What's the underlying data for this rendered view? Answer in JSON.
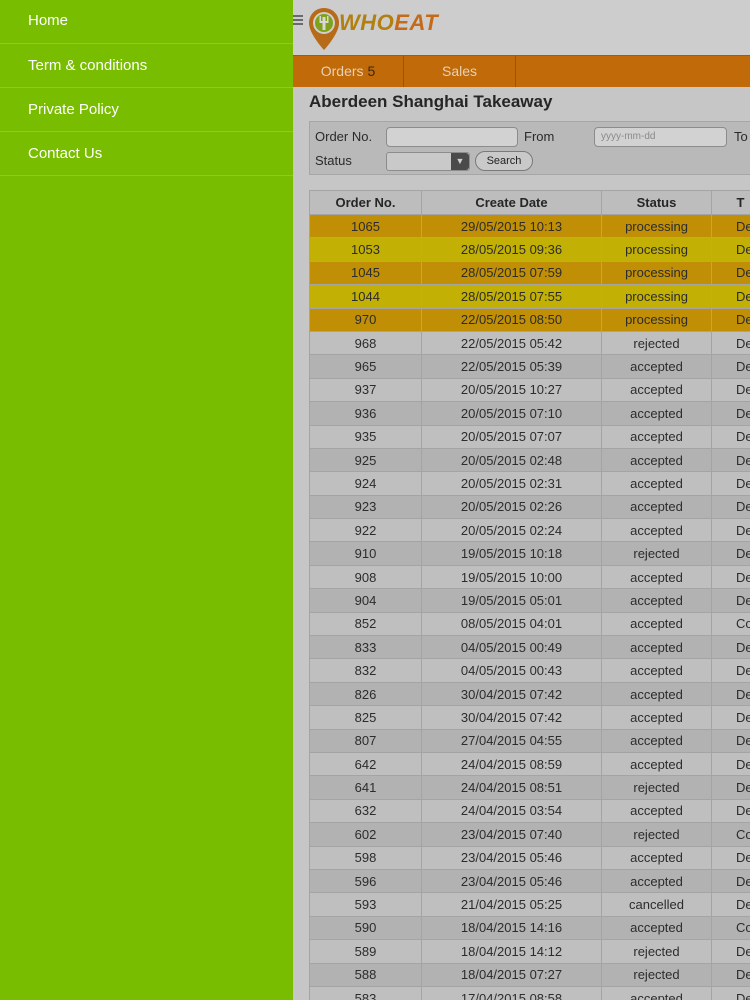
{
  "drawer": {
    "items": [
      {
        "label": "Home"
      },
      {
        "label": "Term & conditions"
      },
      {
        "label": "Private Policy"
      },
      {
        "label": "Contact Us"
      }
    ]
  },
  "header": {
    "logo_text_who": "WHO",
    "logo_text_eat": "EAT",
    "tabs": {
      "orders_label": "Orders",
      "orders_count": "5",
      "sales_label": "Sales"
    }
  },
  "store_title": "Aberdeen Shanghai Takeaway",
  "filter": {
    "order_no_label": "Order No.",
    "from_label": "From",
    "from_placeholder": "yyyy-mm-dd",
    "to_label": "To",
    "status_label": "Status",
    "search_label": "Search"
  },
  "table": {
    "headers": [
      "Order No.",
      "Create Date",
      "Status",
      "T"
    ],
    "rows": [
      {
        "order": "1065",
        "date": "29/05/2015 10:13",
        "status": "processing",
        "type": "De",
        "style": "proc-a"
      },
      {
        "order": "1053",
        "date": "28/05/2015 09:36",
        "status": "processing",
        "type": "De",
        "style": "proc-b"
      },
      {
        "order": "1045",
        "date": "28/05/2015 07:59",
        "status": "processing",
        "type": "De",
        "style": "proc-a"
      },
      {
        "order": "1044",
        "date": "28/05/2015 07:55",
        "status": "processing",
        "type": "De",
        "style": "proc-b"
      },
      {
        "order": "970",
        "date": "22/05/2015 08:50",
        "status": "processing",
        "type": "De",
        "style": "proc-a"
      },
      {
        "order": "968",
        "date": "22/05/2015 05:42",
        "status": "rejected",
        "type": "De",
        "style": "odd"
      },
      {
        "order": "965",
        "date": "22/05/2015 05:39",
        "status": "accepted",
        "type": "De",
        "style": "even"
      },
      {
        "order": "937",
        "date": "20/05/2015 10:27",
        "status": "accepted",
        "type": "De",
        "style": "odd"
      },
      {
        "order": "936",
        "date": "20/05/2015 07:10",
        "status": "accepted",
        "type": "De",
        "style": "even"
      },
      {
        "order": "935",
        "date": "20/05/2015 07:07",
        "status": "accepted",
        "type": "De",
        "style": "odd"
      },
      {
        "order": "925",
        "date": "20/05/2015 02:48",
        "status": "accepted",
        "type": "De",
        "style": "even"
      },
      {
        "order": "924",
        "date": "20/05/2015 02:31",
        "status": "accepted",
        "type": "De",
        "style": "odd"
      },
      {
        "order": "923",
        "date": "20/05/2015 02:26",
        "status": "accepted",
        "type": "De",
        "style": "even"
      },
      {
        "order": "922",
        "date": "20/05/2015 02:24",
        "status": "accepted",
        "type": "De",
        "style": "odd"
      },
      {
        "order": "910",
        "date": "19/05/2015 10:18",
        "status": "rejected",
        "type": "De",
        "style": "even"
      },
      {
        "order": "908",
        "date": "19/05/2015 10:00",
        "status": "accepted",
        "type": "De",
        "style": "odd"
      },
      {
        "order": "904",
        "date": "19/05/2015 05:01",
        "status": "accepted",
        "type": "De",
        "style": "even"
      },
      {
        "order": "852",
        "date": "08/05/2015 04:01",
        "status": "accepted",
        "type": "Col",
        "style": "odd"
      },
      {
        "order": "833",
        "date": "04/05/2015 00:49",
        "status": "accepted",
        "type": "De",
        "style": "even"
      },
      {
        "order": "832",
        "date": "04/05/2015 00:43",
        "status": "accepted",
        "type": "De",
        "style": "odd"
      },
      {
        "order": "826",
        "date": "30/04/2015 07:42",
        "status": "accepted",
        "type": "De",
        "style": "even"
      },
      {
        "order": "825",
        "date": "30/04/2015 07:42",
        "status": "accepted",
        "type": "De",
        "style": "odd"
      },
      {
        "order": "807",
        "date": "27/04/2015 04:55",
        "status": "accepted",
        "type": "De",
        "style": "even"
      },
      {
        "order": "642",
        "date": "24/04/2015 08:59",
        "status": "accepted",
        "type": "De",
        "style": "odd"
      },
      {
        "order": "641",
        "date": "24/04/2015 08:51",
        "status": "rejected",
        "type": "De",
        "style": "even"
      },
      {
        "order": "632",
        "date": "24/04/2015 03:54",
        "status": "accepted",
        "type": "De",
        "style": "odd"
      },
      {
        "order": "602",
        "date": "23/04/2015 07:40",
        "status": "rejected",
        "type": "Col",
        "style": "even"
      },
      {
        "order": "598",
        "date": "23/04/2015 05:46",
        "status": "accepted",
        "type": "De",
        "style": "odd"
      },
      {
        "order": "596",
        "date": "23/04/2015 05:46",
        "status": "accepted",
        "type": "De",
        "style": "even"
      },
      {
        "order": "593",
        "date": "21/04/2015 05:25",
        "status": "cancelled",
        "type": "De",
        "style": "odd"
      },
      {
        "order": "590",
        "date": "18/04/2015 14:16",
        "status": "accepted",
        "type": "Col",
        "style": "even"
      },
      {
        "order": "589",
        "date": "18/04/2015 14:12",
        "status": "rejected",
        "type": "De",
        "style": "odd"
      },
      {
        "order": "588",
        "date": "18/04/2015 07:27",
        "status": "rejected",
        "type": "De",
        "style": "even"
      },
      {
        "order": "583",
        "date": "17/04/2015 08:58",
        "status": "accepted",
        "type": "De",
        "style": "odd"
      }
    ]
  },
  "colors": {
    "drawer_bg": "#78bd00",
    "tab_bar": "#c06a0a",
    "processing_a": "#c08f06",
    "processing_b": "#c2b005"
  }
}
